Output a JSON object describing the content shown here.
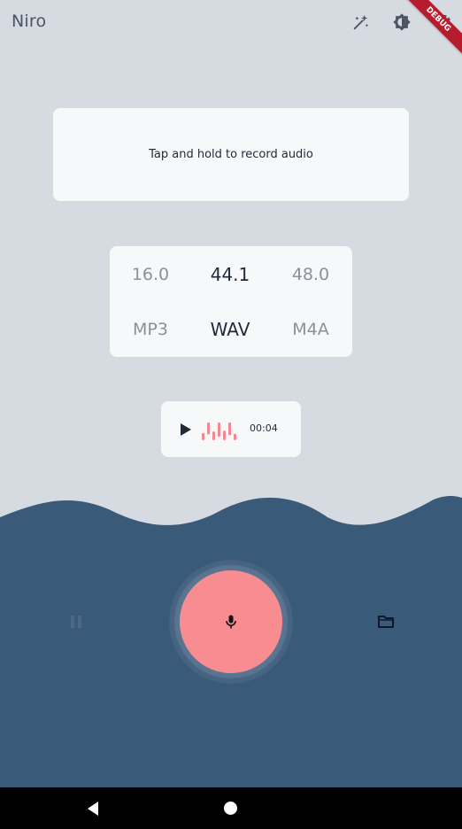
{
  "app": {
    "title": "Niro",
    "debug_label": "DEBUG"
  },
  "toolbar": {
    "icons": [
      "magic-wand-icon",
      "theme-toggle-icon",
      "settings-icon"
    ]
  },
  "hint": {
    "text": "Tap and hold to record audio"
  },
  "sample_rates": {
    "options": [
      "16.0",
      "44.1",
      "48.0"
    ],
    "selected": "44.1"
  },
  "formats": {
    "options": [
      "MP3",
      "WAV",
      "M4A"
    ],
    "selected": "WAV"
  },
  "player": {
    "duration": "00:04",
    "waveform_levels": [
      0.45,
      0.75,
      0.55,
      0.9,
      0.6,
      0.8,
      0.4
    ]
  },
  "colors": {
    "background": "#d6dbe2",
    "card": "#f7f8fa",
    "panel": "#3a5a7a",
    "record": "#f78c91",
    "waveform": "#f4878f",
    "debug_ribbon": "#b71c2c"
  },
  "controls": {
    "left_icon": "pause-icon",
    "center_icon": "microphone-icon",
    "right_icon": "folder-icon"
  },
  "system_nav": {
    "icons": [
      "back-icon",
      "home-icon"
    ]
  }
}
